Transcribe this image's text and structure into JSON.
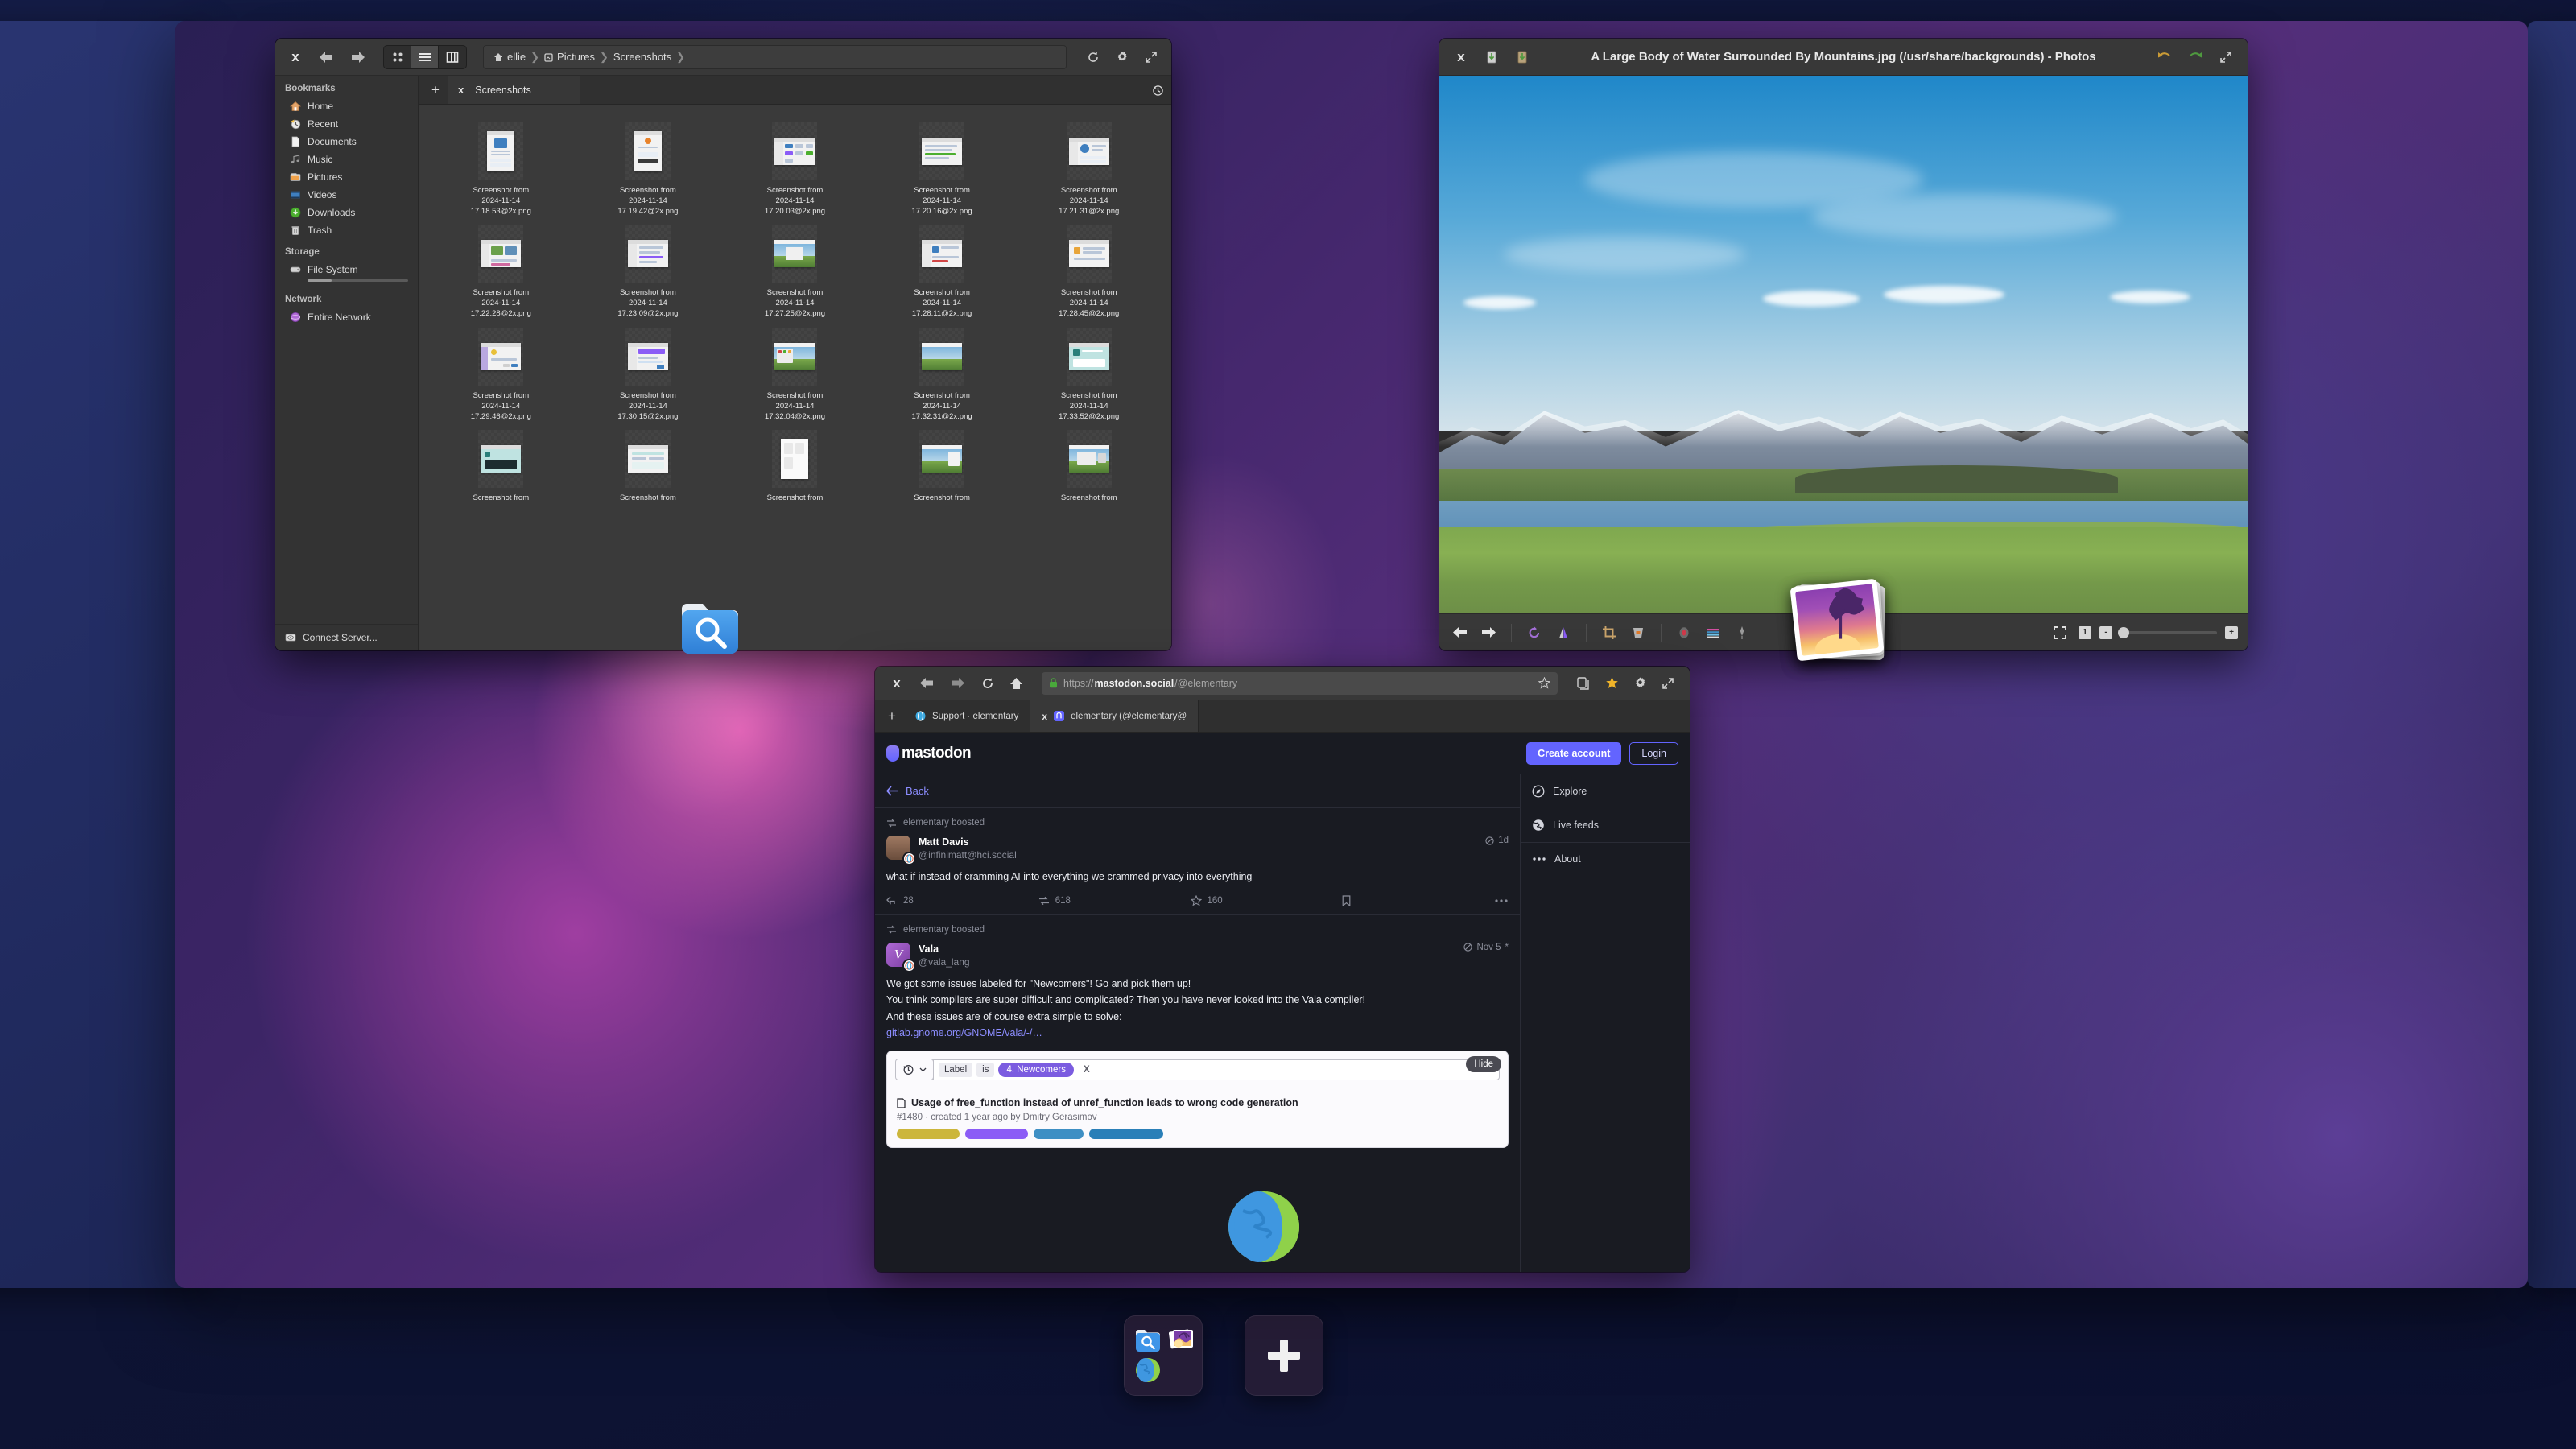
{
  "desktop": {
    "environment": "multitasking-view",
    "wallpaper_name": "Magnolia",
    "accent": "#6364ff"
  },
  "files_window": {
    "title_visible": false,
    "close_label": "x",
    "back_label": "Back",
    "forward_label": "Forward",
    "view_modes": [
      "icon-view",
      "list-view",
      "column-view"
    ],
    "active_view_mode": "list-view",
    "breadcrumbs": [
      "ellie",
      "Pictures",
      "Screenshots"
    ],
    "refresh_label": "Refresh",
    "menu_label": "Menu",
    "maximize_label": "Maximize",
    "tabs": {
      "new_tab_label": "+",
      "items": [
        {
          "label": "Screenshots",
          "close": "x"
        }
      ],
      "history_label": "History"
    },
    "sidebar": {
      "groups": [
        {
          "heading": "Bookmarks",
          "items": [
            {
              "label": "Home",
              "icon": "home-icon"
            },
            {
              "label": "Recent",
              "icon": "recent-icon"
            },
            {
              "label": "Documents",
              "icon": "document-icon"
            },
            {
              "label": "Music",
              "icon": "music-icon"
            },
            {
              "label": "Pictures",
              "icon": "pictures-icon"
            },
            {
              "label": "Videos",
              "icon": "videos-icon"
            },
            {
              "label": "Downloads",
              "icon": "downloads-icon"
            },
            {
              "label": "Trash",
              "icon": "trash-icon"
            }
          ]
        },
        {
          "heading": "Storage",
          "items": [
            {
              "label": "File System",
              "icon": "drive-icon",
              "capacity_fill_percent": 24
            }
          ]
        },
        {
          "heading": "Network",
          "items": [
            {
              "label": "Entire Network",
              "icon": "network-icon"
            }
          ]
        }
      ],
      "connect_server": "Connect Server..."
    },
    "files": [
      {
        "name": "Screenshot from 2024-11-14 17.18.53@2x.png",
        "thumb": "doc-welcome"
      },
      {
        "name": "Screenshot from 2024-11-14 17.19.42@2x.png",
        "thumb": "doc-updates"
      },
      {
        "name": "Screenshot from 2024-11-14 17.20.03@2x.png",
        "thumb": "appcenter"
      },
      {
        "name": "Screenshot from 2024-11-14 17.20.16@2x.png",
        "thumb": "list"
      },
      {
        "name": "Screenshot from 2024-11-14 17.21.31@2x.png",
        "thumb": "profile"
      },
      {
        "name": "Screenshot from 2024-11-14 17.22.28@2x.png",
        "thumb": "gallery"
      },
      {
        "name": "Screenshot from 2024-11-14 17.23.09@2x.png",
        "thumb": "settings"
      },
      {
        "name": "Screenshot from 2024-11-14 17.27.25@2x.png",
        "thumb": "desktop"
      },
      {
        "name": "Screenshot from 2024-11-14 17.28.11@2x.png",
        "thumb": "panel"
      },
      {
        "name": "Screenshot from 2024-11-14 17.28.45@2x.png",
        "thumb": "web"
      },
      {
        "name": "Screenshot from 2024-11-14 17.29.46@2x.png",
        "thumb": "dialog"
      },
      {
        "name": "Screenshot from 2024-11-14 17.30.15@2x.png",
        "thumb": "chat"
      },
      {
        "name": "Screenshot from 2024-11-14 17.32.04@2x.png",
        "thumb": "desktop-apps"
      },
      {
        "name": "Screenshot from 2024-11-14 17.32.31@2x.png",
        "thumb": "desktop-plain"
      },
      {
        "name": "Screenshot from 2024-11-14 17.33.52@2x.png",
        "thumb": "teal-site"
      },
      {
        "name": "Screenshot from",
        "thumb": "teal-card"
      },
      {
        "name": "Screenshot from",
        "thumb": "doc-page"
      },
      {
        "name": "Screenshot from",
        "thumb": "folder"
      },
      {
        "name": "Screenshot from",
        "thumb": "desktop-lake"
      },
      {
        "name": "Screenshot from",
        "thumb": "desktop-win"
      }
    ]
  },
  "photos_window": {
    "title": "A Large Body of Water Surrounded By Mountains.jpg (/usr/share/backgrounds) - Photos",
    "close_label": "x",
    "import_label": "Import",
    "export_label": "Export",
    "undo_label": "Undo",
    "redo_label": "Redo",
    "maximize_label": "Maximize",
    "toolbar": [
      {
        "name": "previous-photo-button",
        "icon": "arrow-left-icon"
      },
      {
        "name": "next-photo-button",
        "icon": "arrow-right-icon"
      },
      {
        "name": "rotate-button",
        "icon": "rotate-icon"
      },
      {
        "name": "flip-button",
        "icon": "flip-icon"
      },
      {
        "name": "crop-button",
        "icon": "crop-icon"
      },
      {
        "name": "straighten-button",
        "icon": "straighten-icon"
      },
      {
        "name": "red-eye-button",
        "icon": "red-eye-icon"
      },
      {
        "name": "adjust-button",
        "icon": "adjust-icon"
      },
      {
        "name": "enhance-button",
        "icon": "enhance-icon"
      }
    ],
    "zoom": {
      "fit_label": "Fit to page",
      "actual_size_label": "1",
      "minus_label": "-",
      "plus_label": "+",
      "slider_position_percent": 0
    },
    "image_alt": "A large body of water surrounded by snow-capped mountains and green grassland"
  },
  "browser_window": {
    "close_label": "x",
    "back_label": "Back",
    "forward_label": "Forward",
    "reload_label": "Reload",
    "home_label": "Home",
    "url": {
      "scheme": "https://",
      "host": "mastodon.social",
      "path": "/@elementary",
      "secure": true
    },
    "bookmark_star_label": "Bookmark this page",
    "tabs_overview_label": "View open pages",
    "bookmarks_label": "Bookmarks",
    "menu_label": "Menu",
    "maximize_label": "Maximize",
    "new_tab_label": "+",
    "tabs": [
      {
        "label": "Support · elementary",
        "active": false,
        "favicon": "elementary-icon"
      },
      {
        "label": "elementary (@elementary@",
        "active": true,
        "favicon": "mastodon-icon",
        "close": "x"
      }
    ]
  },
  "mastodon": {
    "brand": "mastodon",
    "create_account_label": "Create account",
    "login_label": "Login",
    "back_label": "Back",
    "statuses": [
      {
        "boost_label": "elementary boosted",
        "display_name": "Matt Davis",
        "account": "@infinimatt@hci.social",
        "timestamp": "1d",
        "body": "what if instead of cramming AI into everything we crammed privacy into everything",
        "replies": "28",
        "boosts": "618",
        "favourites": "160",
        "bookmark_label": "Bookmark",
        "more_label": "More"
      },
      {
        "boost_label": "elementary boosted",
        "display_name": "Vala",
        "account": "@vala_lang",
        "timestamp": "Nov 5",
        "edited_marker": "*",
        "body_lines": [
          "We got some issues labeled for \"Newcomers\"! Go and pick them up!",
          "You think compilers are super difficult and complicated? Then you have never looked into the Vala compiler!",
          "And these issues are of course extra simple to solve:"
        ],
        "link": "gitlab.gnome.org/GNOME/vala/-/…"
      }
    ],
    "sidebar": [
      {
        "label": "Explore",
        "icon": "compass-icon"
      },
      {
        "label": "Live feeds",
        "icon": "globe-icon"
      },
      {
        "label": "About",
        "icon": "ellipsis-icon"
      }
    ]
  },
  "link_preview": {
    "hide_label": "Hide",
    "recent_searches_label": "Recent searches",
    "filter_key": "Label",
    "filter_operator": "is",
    "filter_value": "4. Newcomers",
    "filter_clear_label": "X",
    "issue_title": "Usage of free_function instead of unref_function leads to wrong code generation",
    "issue_meta": "#1480 · created 1 year ago by Dmitry Gerasimov",
    "issue_labels": [
      "#ccb63c",
      "#8b5cf6",
      "#3e8fc4",
      "#2a7fb8"
    ]
  },
  "dock": {
    "workspace_thumb_label": "Current workspace",
    "apps": [
      {
        "name": "files-app-icon",
        "label": "Files"
      },
      {
        "name": "photos-app-icon",
        "label": "Photos"
      },
      {
        "name": "web-app-icon",
        "label": "Web"
      }
    ],
    "add_workspace_label": "+"
  }
}
